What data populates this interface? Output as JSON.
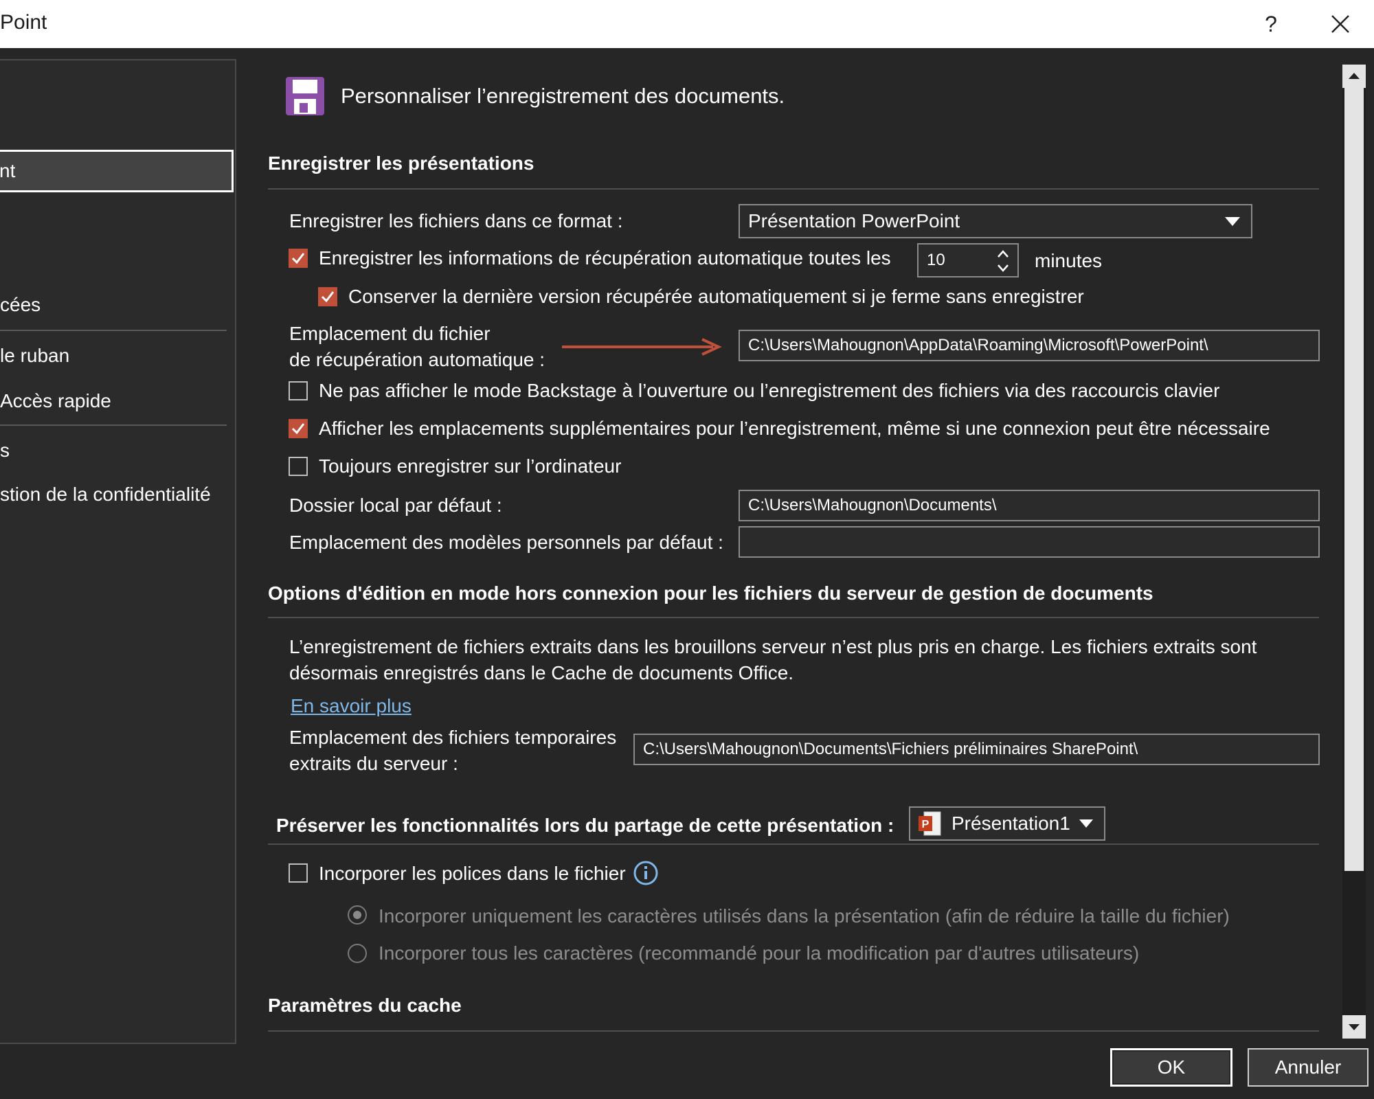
{
  "window": {
    "title": "Point",
    "help": "?",
    "close": "✕"
  },
  "nav": {
    "items": [
      "nt",
      "cées",
      " le ruban",
      " Accès rapide",
      "s",
      "stion de la confidentialité"
    ]
  },
  "header": {
    "title": "Personnaliser l’enregistrement des documents."
  },
  "save_section": {
    "heading": "Enregistrer les présentations",
    "format_label": "Enregistrer les fichiers dans ce format :",
    "format_value": "Présentation PowerPoint",
    "autorecover_label": "Enregistrer les informations de récupération automatique toutes les",
    "autorecover_checked": true,
    "autorecover_minutes": "10",
    "minutes_label": "minutes",
    "keep_version_label": "Conserver la dernière version récupérée automatiquement si je ferme sans enregistrer",
    "keep_version_checked": true,
    "autorecover_location_label_1": "Emplacement du fichier",
    "autorecover_location_label_2": "de récupération automatique :",
    "autorecover_location_value": "C:\\Users\\Mahougnon\\AppData\\Roaming\\Microsoft\\PowerPoint\\",
    "no_backstage_label": "Ne pas afficher le mode Backstage à l’ouverture ou l’enregistrement des fichiers via des raccourcis clavier",
    "no_backstage_checked": false,
    "show_locations_label": "Afficher les emplacements supplémentaires pour l’enregistrement, même si une connexion peut être nécessaire",
    "show_locations_checked": true,
    "always_local_label": "Toujours enregistrer sur l’ordinateur",
    "always_local_checked": false,
    "default_folder_label": "Dossier local par défaut :",
    "default_folder_value": "C:\\Users\\Mahougnon\\Documents\\",
    "templates_label": "Emplacement des modèles personnels par défaut :",
    "templates_value": ""
  },
  "offline_section": {
    "heading": "Options d'édition en mode hors connexion pour les fichiers du serveur de gestion de documents",
    "info_line_1": "L’enregistrement de fichiers extraits dans les brouillons serveur n’est plus pris en charge. Les fichiers extraits sont",
    "info_line_2": "désormais enregistrés dans le Cache de documents Office.",
    "learn_more": "En savoir plus",
    "temp_label_1": "Emplacement des fichiers temporaires",
    "temp_label_2": "extraits du serveur :",
    "temp_value": "C:\\Users\\Mahougnon\\Documents\\Fichiers préliminaires SharePoint\\"
  },
  "preserve_section": {
    "heading": "Préserver les fonctionnalités lors du partage de cette présentation :",
    "presentation_value": "Présentation1",
    "embed_fonts_label": "Incorporer les polices dans le fichier",
    "embed_fonts_checked": false,
    "embed_used_label": "Incorporer uniquement les caractères utilisés dans la présentation (afin de réduire la taille du fichier)",
    "embed_all_label": "Incorporer tous les caractères (recommandé pour la modification par d'autres utilisateurs)"
  },
  "cache_section": {
    "heading": "Paramètres du cache"
  },
  "buttons": {
    "ok": "OK",
    "cancel": "Annuler"
  },
  "colors": {
    "accent_check": "#c0503a",
    "arrow": "#c0503a",
    "link": "#7fb8e8",
    "save_icon": "#8b4fa8"
  }
}
